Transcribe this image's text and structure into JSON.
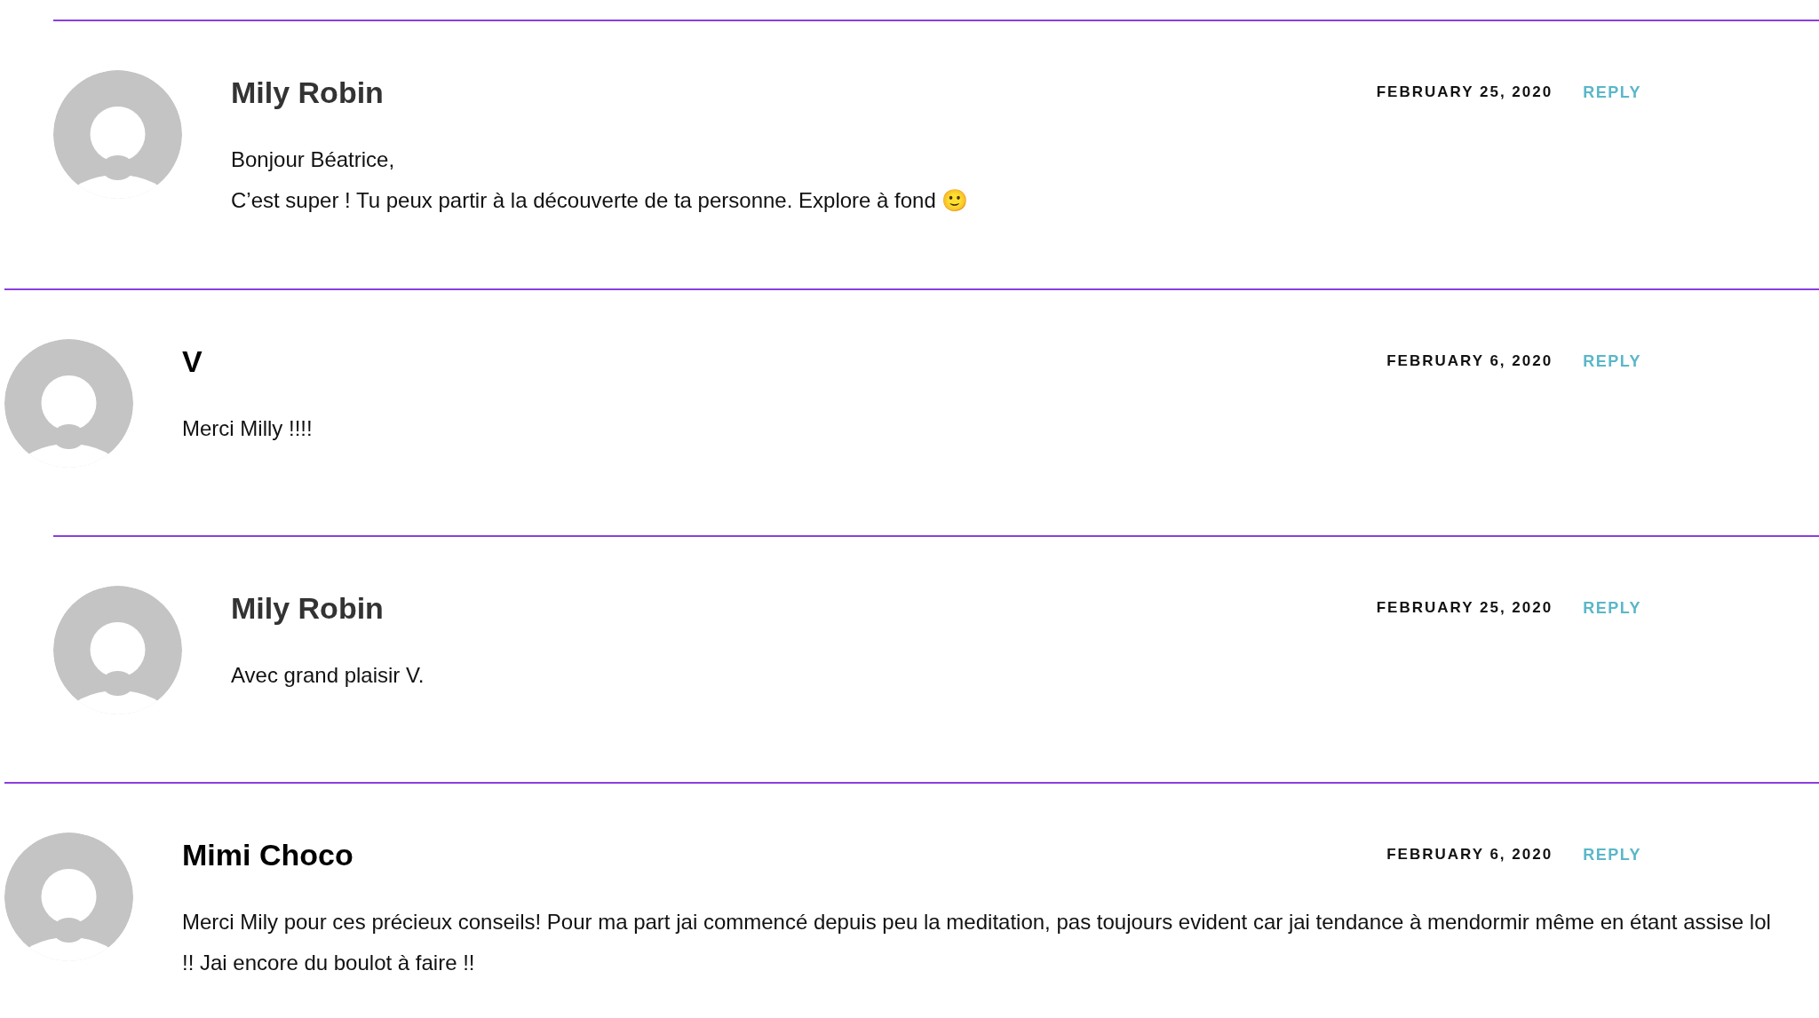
{
  "comments": [
    {
      "kind": "reply",
      "author": "Mily Robin",
      "date": "FEBRUARY 25, 2020",
      "reply_link": "REPLY",
      "body": [
        "Bonjour Béatrice,",
        "C’est super ! Tu peux partir à la découverte de ta personne. Explore à fond 🙂"
      ]
    },
    {
      "kind": "comment",
      "author": "V",
      "date": "FEBRUARY 6, 2020",
      "reply_link": "REPLY",
      "body": [
        "Merci Milly !!!!"
      ]
    },
    {
      "kind": "reply",
      "author": "Mily Robin",
      "date": "FEBRUARY 25, 2020",
      "reply_link": "REPLY",
      "body": [
        "Avec grand plaisir V."
      ]
    },
    {
      "kind": "comment",
      "author": "Mimi Choco",
      "date": "FEBRUARY 6, 2020",
      "reply_link": "REPLY",
      "body": [
        "Merci Mily pour ces précieux conseils! Pour ma part jai commencé depuis peu la meditation, pas toujours evident car jai tendance à mendormir même en étant assise lol !! Jai encore du boulot à faire !!"
      ]
    }
  ]
}
